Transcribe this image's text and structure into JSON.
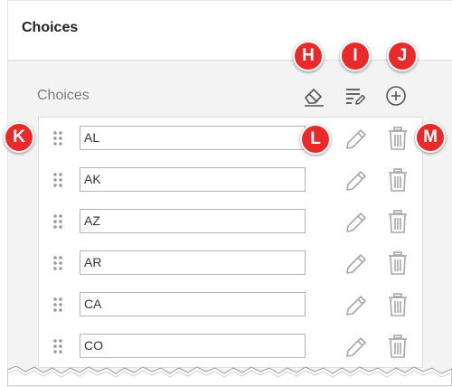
{
  "section": {
    "title": "Choices"
  },
  "panel": {
    "label": "Choices"
  },
  "toolbar": {
    "clear_icon": "eraser-icon",
    "bulk_edit_icon": "lines-pencil-icon",
    "add_icon": "plus-circle-icon"
  },
  "choices": [
    {
      "value": "AL"
    },
    {
      "value": "AK"
    },
    {
      "value": "AZ"
    },
    {
      "value": "AR"
    },
    {
      "value": "CA"
    },
    {
      "value": "CO"
    }
  ],
  "row_icons": {
    "drag": "drag-dots-icon",
    "edit": "pencil-icon",
    "delete": "trash-icon"
  },
  "callouts": [
    "H",
    "I",
    "J",
    "K",
    "L",
    "M"
  ],
  "colors": {
    "callout": "#ea2a2a",
    "icon": "#a8a8a8",
    "toolbar_icon": "#555555"
  }
}
